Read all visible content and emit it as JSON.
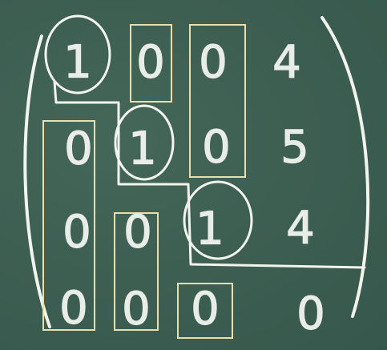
{
  "matrix": {
    "row1": {
      "c1": "1",
      "c2": "0",
      "c3": "0",
      "c4": "4"
    },
    "row2": {
      "c1": "0",
      "c2": "1",
      "c3": "0",
      "c4": "5"
    },
    "row3": {
      "c1": "0",
      "c2": "0",
      "c3": "1",
      "c4": "4"
    },
    "row4": {
      "c1": "0",
      "c2": "0",
      "c3": "0",
      "c4": "0"
    }
  },
  "colors": {
    "board": "#3d5f52",
    "chalk": "#f2f4ee",
    "highlight_box": "#e9dfae"
  }
}
